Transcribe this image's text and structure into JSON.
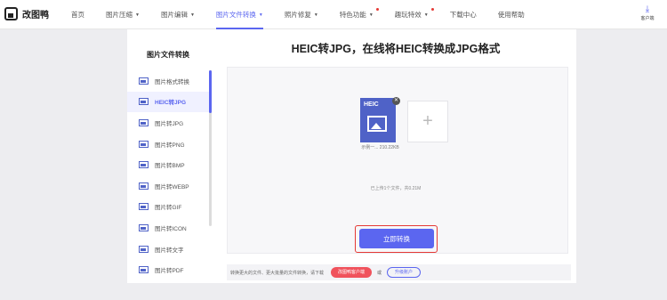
{
  "brand": {
    "name": "改图鸭"
  },
  "nav": {
    "items": [
      {
        "label": "首页",
        "caret": false,
        "dot": false,
        "active": false
      },
      {
        "label": "图片压缩",
        "caret": true,
        "dot": false,
        "active": false
      },
      {
        "label": "图片编辑",
        "caret": true,
        "dot": false,
        "active": false
      },
      {
        "label": "图片文件转换",
        "caret": true,
        "dot": false,
        "active": true
      },
      {
        "label": "照片修复",
        "caret": true,
        "dot": false,
        "active": false
      },
      {
        "label": "特色功能",
        "caret": true,
        "dot": true,
        "active": false
      },
      {
        "label": "趣玩特效",
        "caret": true,
        "dot": true,
        "active": false
      },
      {
        "label": "下载中心",
        "caret": false,
        "dot": false,
        "active": false
      },
      {
        "label": "使用帮助",
        "caret": false,
        "dot": false,
        "active": false
      }
    ],
    "client_label": "客户端"
  },
  "sidebar": {
    "title": "图片文件转换",
    "items": [
      {
        "label": "图片格式转换"
      },
      {
        "label": "HEIC转JPG"
      },
      {
        "label": "图片转JPG"
      },
      {
        "label": "图片转PNG"
      },
      {
        "label": "图片转BMP"
      },
      {
        "label": "图片转WEBP"
      },
      {
        "label": "图片转GIF"
      },
      {
        "label": "图片转ICON"
      },
      {
        "label": "图片转文字"
      },
      {
        "label": "图片转PDF"
      }
    ],
    "active_index": 1
  },
  "main": {
    "title": "HEIC转JPG，在线将HEIC转换成JPG格式",
    "file": {
      "badge": "HEIC",
      "name": "示例一... 210.22KB"
    },
    "add_symbol": "+",
    "upload_info": "已上传1个文件，共0.21M",
    "convert_label": "立即转换"
  },
  "notice": {
    "text": "转换更大的文件、更大批量的文件转换，请下载",
    "client_button": "改图鸭客户端",
    "or": "或",
    "upgrade_button": "升级账户"
  },
  "colors": {
    "accent": "#5b66f0",
    "file_icon": "#4f62c7",
    "highlight": "#e53935"
  }
}
